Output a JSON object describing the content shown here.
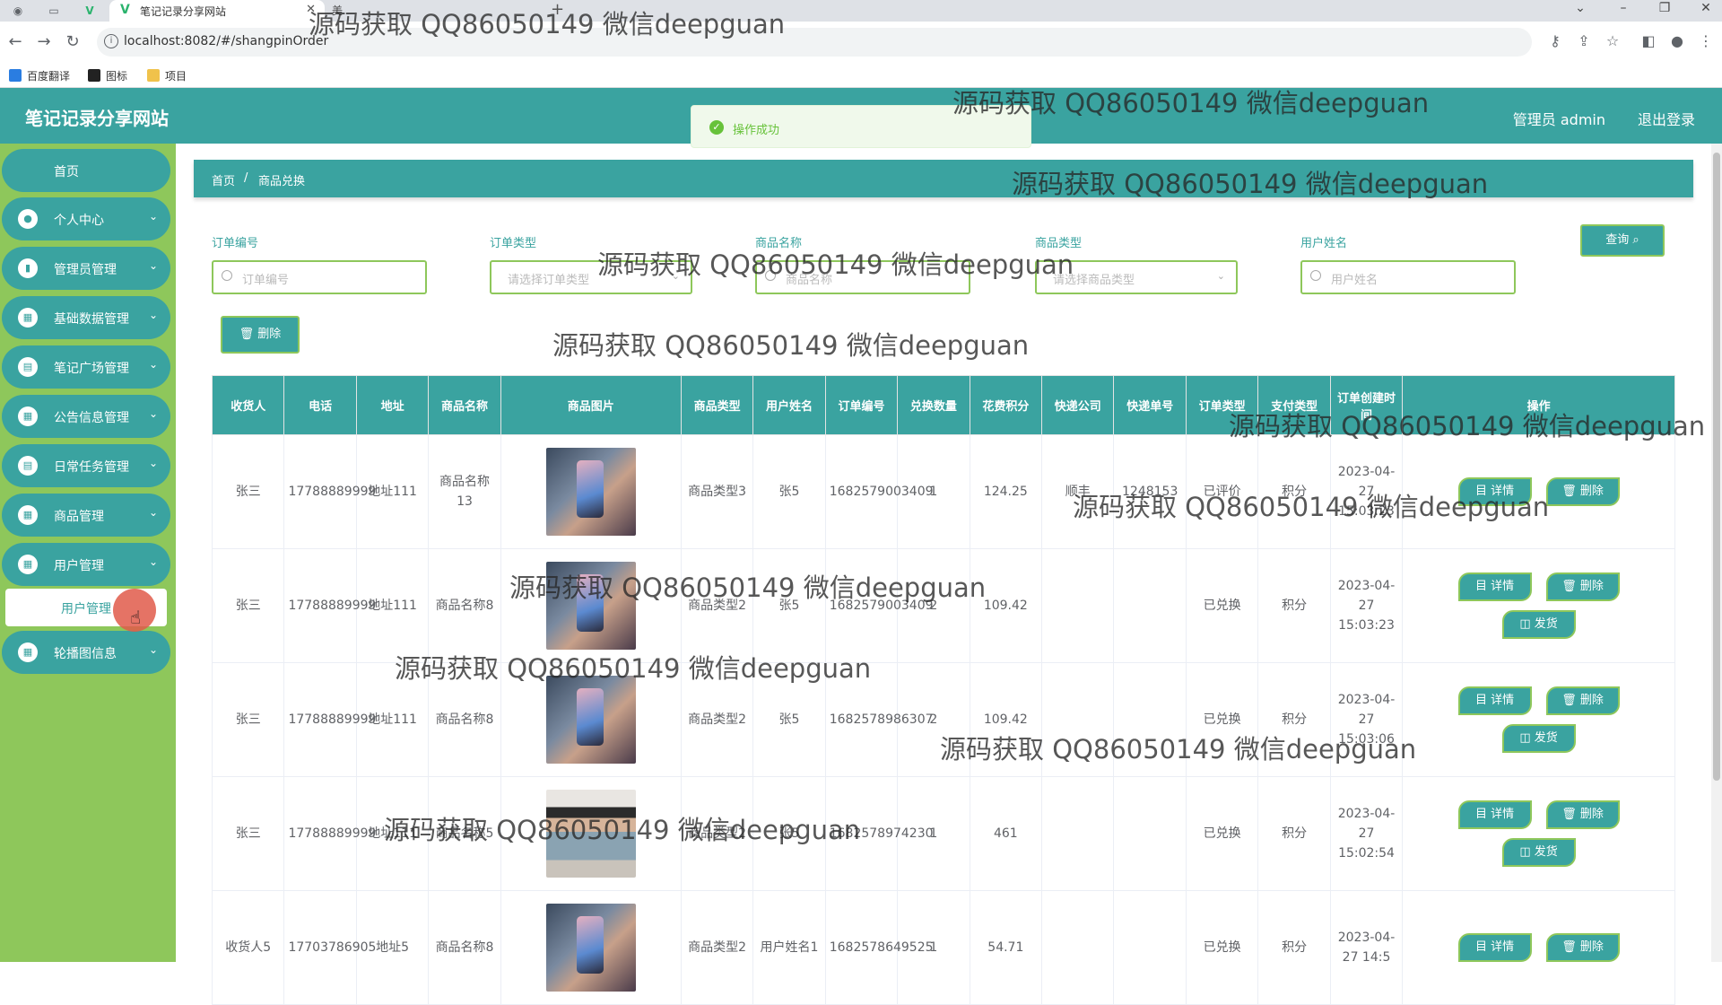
{
  "browser": {
    "tab_title": "笔记记录分享网站",
    "tab2_title": "美",
    "url": "localhost:8082/#/shangpinOrder",
    "bookmarks": [
      "百度翻译",
      "图标",
      "项目"
    ]
  },
  "header": {
    "brand": "笔记记录分享网站",
    "user": "管理员 admin",
    "logout": "退出登录",
    "toast": "操作成功"
  },
  "sidebar": {
    "home": "首页",
    "items": [
      {
        "label": "个人中心"
      },
      {
        "label": "管理员管理"
      },
      {
        "label": "基础数据管理"
      },
      {
        "label": "笔记广场管理"
      },
      {
        "label": "公告信息管理"
      },
      {
        "label": "日常任务管理"
      },
      {
        "label": "商品管理"
      },
      {
        "label": "用户管理"
      },
      {
        "label": "轮播图信息"
      }
    ],
    "active_sub": "用户管理"
  },
  "breadcrumb": {
    "home": "首页",
    "sep": "/",
    "current": "商品兑换"
  },
  "filters": {
    "order_no": {
      "label": "订单编号",
      "placeholder": "订单编号"
    },
    "order_type": {
      "label": "订单类型",
      "placeholder": "请选择订单类型"
    },
    "product_name": {
      "label": "商品名称",
      "placeholder": "商品名称"
    },
    "product_type": {
      "label": "商品类型",
      "placeholder": "请选择商品类型"
    },
    "user_name": {
      "label": "用户姓名",
      "placeholder": "用户姓名"
    },
    "query": "查询 ⌕",
    "delete": "🗑 删除"
  },
  "table": {
    "columns": [
      "收货人",
      "电话",
      "地址",
      "商品名称",
      "商品图片",
      "商品类型",
      "用户姓名",
      "订单编号",
      "兑换数量",
      "花费积分",
      "快递公司",
      "快递单号",
      "订单类型",
      "支付类型",
      "订单创建时间",
      "操作"
    ],
    "rows": [
      {
        "receiver": "张三",
        "phone": "17788889999",
        "address": "地址111",
        "name": "商品名称13",
        "img": "phone",
        "type": "商品类型3",
        "user": "张5",
        "order": "1682579003409",
        "qty": "1",
        "points": "124.25",
        "express": "顺丰",
        "express_no": "1248153",
        "order_type": "已评价",
        "pay": "积分",
        "time": "2023-04-27 15:03:23",
        "ship": false
      },
      {
        "receiver": "张三",
        "phone": "17788889999",
        "address": "地址111",
        "name": "商品名称8",
        "img": "phone",
        "type": "商品类型2",
        "user": "张5",
        "order": "1682579003409",
        "qty": "2",
        "points": "109.42",
        "express": "",
        "express_no": "",
        "order_type": "已兑换",
        "pay": "积分",
        "time": "2023-04-27 15:03:23",
        "ship": true
      },
      {
        "receiver": "张三",
        "phone": "17788889999",
        "address": "地址111",
        "name": "商品名称8",
        "img": "phone",
        "type": "商品类型2",
        "user": "张5",
        "order": "1682578986307",
        "qty": "2",
        "points": "109.42",
        "express": "",
        "express_no": "",
        "order_type": "已兑换",
        "pay": "积分",
        "time": "2023-04-27 15:03:06",
        "ship": true
      },
      {
        "receiver": "张三",
        "phone": "17788889999",
        "address": "地址111",
        "name": "商品名称5",
        "img": "person",
        "type": "商品类型2",
        "user": "张5",
        "order": "1682578974230",
        "qty": "1",
        "points": "461",
        "express": "",
        "express_no": "",
        "order_type": "已兑换",
        "pay": "积分",
        "time": "2023-04-27 15:02:54",
        "ship": true
      },
      {
        "receiver": "收货人5",
        "phone": "17703786905",
        "address": "地址5",
        "name": "商品名称8",
        "img": "phone",
        "type": "商品类型2",
        "user": "用户姓名1",
        "order": "1682578649525",
        "qty": "1",
        "points": "54.71",
        "express": "",
        "express_no": "",
        "order_type": "已兑换",
        "pay": "积分",
        "time": "2023-04-27 14:5",
        "ship": false
      }
    ],
    "btn_detail": "目 详情",
    "btn_delete": "🗑 删除",
    "btn_ship": "◫ 发货"
  },
  "watermark": "源码获取 QQ86050149 微信deepguan",
  "colors": {
    "primary": "#3aa3a0",
    "sidebar": "#8ec75b",
    "success": "#67c23a"
  }
}
